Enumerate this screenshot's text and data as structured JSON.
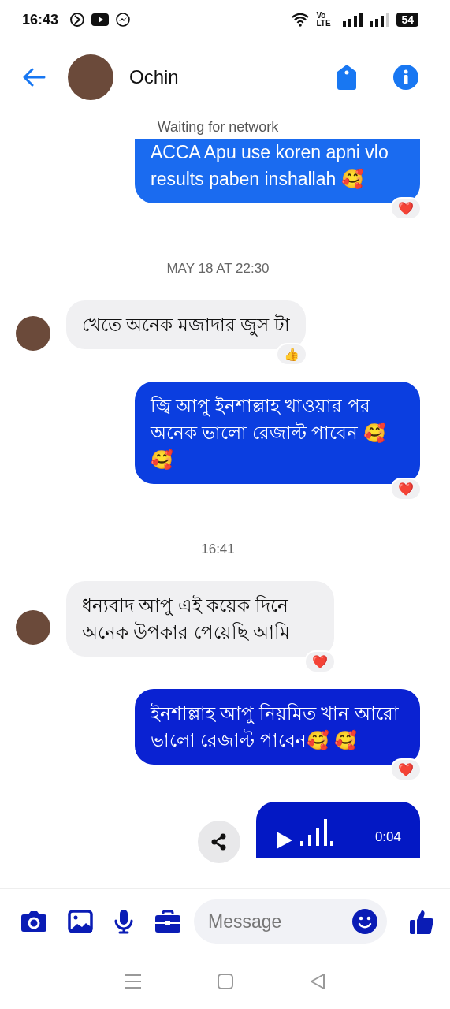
{
  "status_bar": {
    "time": "16:43",
    "network_label": "Vo LTE",
    "battery": "54"
  },
  "header": {
    "contact_name": "Ochin"
  },
  "banner": "Waiting for network",
  "messages": [
    {
      "kind": "out",
      "text": "ACCA Apu use koren apni vlo results paben inshallah 🥰",
      "color": "#1a6bf0",
      "reaction": "❤️"
    },
    {
      "kind": "time",
      "text": "MAY 18 AT 22:30"
    },
    {
      "kind": "in",
      "text": "খেতে অনেক মজাদার জুস টা",
      "reaction": "👍"
    },
    {
      "kind": "out",
      "text": "জ্বি আপু ইনশাল্লাহ খাওয়ার পর অনেক ভালো রেজাল্ট পাবেন 🥰🥰",
      "color": "#0b3ee0",
      "reaction": "❤️"
    },
    {
      "kind": "time",
      "text": "16:41"
    },
    {
      "kind": "in",
      "text": "ধন্যবাদ আপু এই কয়েক দিনে অনেক উপকার পেয়েছি আমি",
      "reaction": "❤️"
    },
    {
      "kind": "out",
      "text": "ইনশাল্লাহ আপু নিয়মিত খান আরো ভালো রেজাল্ট পাবেন🥰 🥰",
      "color": "#0a22d2",
      "reaction": "❤️"
    },
    {
      "kind": "voice",
      "duration": "0:04",
      "color": "#0318c4"
    }
  ],
  "composer": {
    "placeholder": "Message"
  }
}
